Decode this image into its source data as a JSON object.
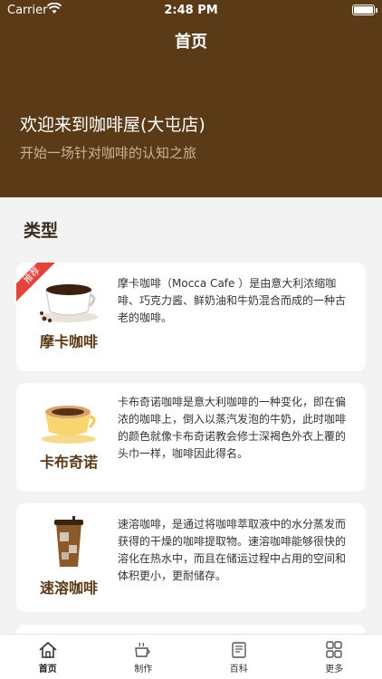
{
  "status_bar": {
    "carrier": "Carrier",
    "time": "2:48 PM"
  },
  "nav": {
    "title": "首页"
  },
  "hero": {
    "welcome": "欢迎来到咖啡屋(大屯店)",
    "subtitle": "开始一场针对咖啡的认知之旅"
  },
  "section": {
    "title": "类型"
  },
  "cards": [
    {
      "name": "摩卡咖啡",
      "badge": "推荐",
      "description": "摩卡咖啡（Mocca Cafe ）是由意大利浓缩咖啡、巧克力酱、鲜奶油和牛奶混合而成的一种古老的咖啡。"
    },
    {
      "name": "卡布奇诺",
      "description": "卡布奇诺咖啡是意大利咖啡的一种变化，即在偏浓的咖啡上，倒入以蒸汽发泡的牛奶，此时咖啡的颜色就像卡布奇诺教会修士深褐色外衣上覆的头巾一样，咖啡因此得名。"
    },
    {
      "name": "速溶咖啡",
      "description": "速溶咖啡，是通过将咖啡萃取液中的水分蒸发而获得的干燥的咖啡提取物。速溶咖啡能够很快的溶化在热水中，而且在储运过程中占用的空间和体积更小，更耐储存。"
    }
  ],
  "tabbar": {
    "items": [
      {
        "label": "首页",
        "icon": "home-icon"
      },
      {
        "label": "制作",
        "icon": "coffee-cup-icon"
      },
      {
        "label": "百科",
        "icon": "book-icon"
      },
      {
        "label": "更多",
        "icon": "grid-icon"
      }
    ]
  }
}
